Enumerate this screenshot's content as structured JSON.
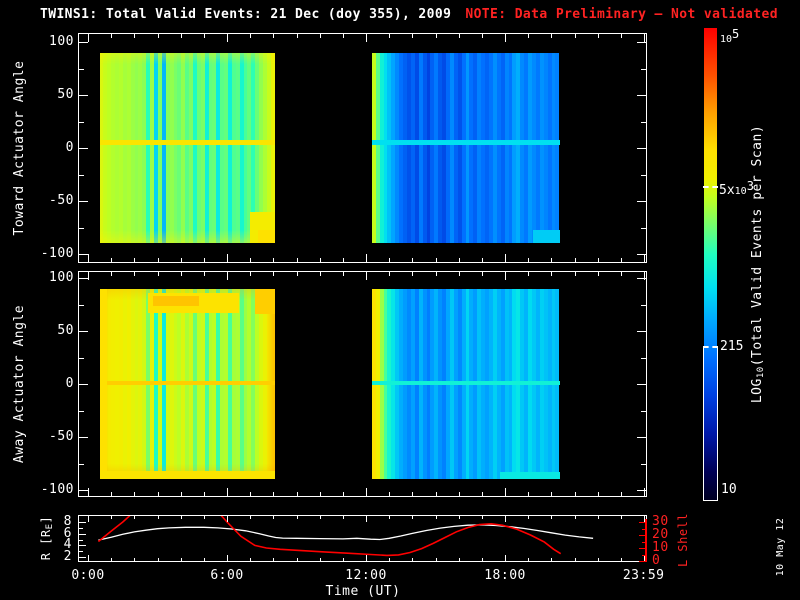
{
  "title": {
    "main": "TWINS1: Total Valid Events: 21 Dec (doy 355), 2009",
    "note": "NOTE: Data Preliminary – Not validated"
  },
  "datestamp": "10 May 12",
  "colors": {
    "background": "#000000",
    "foreground": "#ffffff",
    "note_red": "#ff2222",
    "line_red": "#ff0000",
    "line_white": "#ffffff"
  },
  "colormap": {
    "log10_range": [
      1,
      5
    ],
    "stops": [
      [
        0,
        "#000022"
      ],
      [
        0.06,
        "#000055"
      ],
      [
        0.14,
        "#0018a8"
      ],
      [
        0.22,
        "#0040e0"
      ],
      [
        0.3,
        "#0070ff"
      ],
      [
        0.38,
        "#00a8ff"
      ],
      [
        0.45,
        "#00e0f0"
      ],
      [
        0.52,
        "#20ffc0"
      ],
      [
        0.58,
        "#70ff70"
      ],
      [
        0.64,
        "#c0ff20"
      ],
      [
        0.68,
        "#f0f000"
      ],
      [
        0.74,
        "#ffe000"
      ],
      [
        0.82,
        "#ffa000"
      ],
      [
        0.9,
        "#ff5000"
      ],
      [
        1,
        "#ff0000"
      ]
    ]
  },
  "colorbar": {
    "title_prefix": "LOG",
    "title_sub": "10",
    "title_suffix": "(Total Valid Events per Scan)",
    "top_base": "10",
    "top_sup": "5",
    "mid_prefix": "5x",
    "mid_base": "10",
    "mid_sup": "3",
    "label_215": "215",
    "label_10": "10"
  },
  "time_axis": {
    "label": "Time (UT)",
    "ticks": [
      {
        "hour": 0,
        "label": "0:00"
      },
      {
        "hour": 6,
        "label": "6:00"
      },
      {
        "hour": 12,
        "label": "12:00"
      },
      {
        "hour": 18,
        "label": "18:00"
      },
      {
        "hour": 23.983,
        "label": "23:59"
      }
    ]
  },
  "panels": [
    {
      "id": "toward",
      "ylabel": "Toward Actuator Angle",
      "yticks": [
        100,
        50,
        0,
        -50,
        -100
      ]
    },
    {
      "id": "away",
      "ylabel": "Away Actuator Angle",
      "yticks": [
        100,
        50,
        0,
        -50,
        -100
      ]
    }
  ],
  "strip": {
    "r_label_prefix": "R [R",
    "r_label_sub": "E",
    "r_label_suffix": "]",
    "r_ticks": [
      8,
      6,
      4,
      2
    ],
    "l_label": "L Shell",
    "l_ticks": [
      30,
      20,
      10,
      0
    ]
  },
  "chart_data": {
    "type": "heatmap",
    "title": "TWINS1 Total Valid Events, 21 Dec (doy 355) 2009",
    "x_axis": {
      "label": "Time (UT)",
      "range_hours": [
        0,
        24
      ]
    },
    "y_axis": {
      "label": "Actuator Angle (deg)",
      "range": [
        -100,
        100
      ]
    },
    "value_axis": {
      "label": "LOG10(Total Valid Events per Scan)",
      "log10_range": [
        1,
        5
      ],
      "marked_values": [
        100000,
        5000,
        215,
        10
      ]
    },
    "heatmaps": [
      {
        "panel": "toward",
        "segment": "morning",
        "t0": 0.5,
        "t1": 8.05,
        "angle0": -90,
        "angle1": 90,
        "vignette": "vign-yellow",
        "columns_log10": [
          3.62,
          3.58,
          3.55,
          3.52,
          3.5,
          3.52,
          3.48,
          3.5,
          3.45,
          3.42,
          3.45,
          3.4,
          3.1,
          3.45,
          2.75,
          3.35,
          2.6,
          3.38,
          3.42,
          3.35,
          3.3,
          3.42,
          3.25,
          3.35,
          3.05,
          3.3,
          3.35,
          2.95,
          3.28,
          3.3,
          2.9,
          3.25,
          3.28,
          2.95,
          3.22,
          3.25,
          3.0,
          3.2,
          3.28,
          3.12,
          3.3,
          3.42,
          3.5,
          3.58,
          3.68
        ]
      },
      {
        "panel": "toward",
        "segment": "afternoon",
        "t0": 12.25,
        "t1": 20.35,
        "angle0": -90,
        "angle1": 90,
        "vignette": "",
        "columns_log10": [
          3.58,
          3.25,
          2.95,
          2.8,
          2.65,
          2.5,
          2.35,
          2.2,
          2.1,
          2.0,
          2.12,
          1.95,
          2.25,
          2.05,
          1.9,
          2.1,
          2.25,
          2.05,
          1.95,
          2.15,
          2.35,
          2.12,
          2.0,
          2.2,
          2.42,
          2.2,
          2.1,
          2.3,
          2.2,
          2.12,
          2.22,
          2.38,
          2.22,
          2.12,
          2.32,
          2.22,
          2.45,
          2.55,
          2.35,
          2.25,
          2.45,
          2.35,
          2.25,
          2.4,
          2.32,
          2.22,
          2.35,
          2.3
        ]
      },
      {
        "panel": "away",
        "segment": "morning",
        "t0": 0.5,
        "t1": 8.05,
        "angle0": -90,
        "angle1": 90,
        "vignette": "vign-warm",
        "columns_log10": [
          3.88,
          3.82,
          3.78,
          3.75,
          3.72,
          3.75,
          3.7,
          3.72,
          3.68,
          3.65,
          3.68,
          3.62,
          3.35,
          3.68,
          3.05,
          3.6,
          2.9,
          3.62,
          3.66,
          3.6,
          3.55,
          3.65,
          3.5,
          3.6,
          3.3,
          3.55,
          3.6,
          3.2,
          3.52,
          3.55,
          3.15,
          3.5,
          3.52,
          3.2,
          3.48,
          3.5,
          3.25,
          3.45,
          3.52,
          3.38,
          3.55,
          3.65,
          3.7,
          3.78,
          3.85
        ]
      },
      {
        "panel": "away",
        "segment": "afternoon",
        "t0": 12.25,
        "t1": 20.35,
        "angle0": -90,
        "angle1": 90,
        "vignette": "",
        "columns_log10": [
          3.92,
          3.72,
          3.45,
          3.2,
          3.0,
          2.85,
          2.68,
          2.55,
          2.45,
          2.35,
          2.48,
          2.3,
          2.58,
          2.4,
          2.28,
          2.45,
          2.58,
          2.4,
          2.3,
          2.5,
          2.68,
          2.48,
          2.35,
          2.55,
          2.75,
          2.55,
          2.45,
          2.65,
          2.55,
          2.48,
          2.58,
          2.72,
          2.58,
          2.48,
          2.65,
          2.58,
          2.78,
          2.85,
          2.68,
          2.58,
          2.78,
          2.68,
          2.58,
          2.72,
          2.65,
          2.58,
          2.68,
          2.62
        ]
      }
    ],
    "features": [
      {
        "block": 0,
        "kind": "centerline",
        "angle": 5,
        "half": 2.2,
        "v": 3.88
      },
      {
        "block": 1,
        "kind": "centerline",
        "angle": 5,
        "half": 2.2,
        "v": 2.8
      },
      {
        "block": 2,
        "kind": "centerline",
        "angle": 1,
        "half": 2.2,
        "v": 4.05
      },
      {
        "block": 3,
        "kind": "centerline",
        "angle": 1,
        "half": 2.2,
        "v": 2.95
      },
      {
        "block": 0,
        "kind": "patch",
        "t0": 7.0,
        "t1": 8.05,
        "a0": -90,
        "a1": -60,
        "v": 3.78
      },
      {
        "block": 0,
        "kind": "patch",
        "t0": 7.35,
        "t1": 8.05,
        "a0": -90,
        "a1": -77,
        "v": 3.95
      },
      {
        "block": 2,
        "kind": "patch",
        "t0": 2.6,
        "t1": 6.5,
        "a0": 67,
        "a1": 86,
        "v": 3.92
      },
      {
        "block": 2,
        "kind": "patch",
        "t0": 2.8,
        "t1": 4.8,
        "a0": 74,
        "a1": 83,
        "v": 4.1
      },
      {
        "block": 2,
        "kind": "patch",
        "t0": 7.2,
        "t1": 8.05,
        "a0": 66,
        "a1": 90,
        "v": 4.05
      },
      {
        "block": 2,
        "kind": "patch",
        "t0": 0.5,
        "t1": 0.82,
        "a0": -90,
        "a1": 90,
        "v": 3.95
      },
      {
        "block": 2,
        "kind": "patch",
        "t0": 0.5,
        "t1": 8.05,
        "a0": -90,
        "a1": -82,
        "v": 3.9
      },
      {
        "block": 1,
        "kind": "patch",
        "t0": 19.2,
        "t1": 20.35,
        "a0": -90,
        "a1": -77,
        "v": 2.7
      },
      {
        "block": 3,
        "kind": "patch",
        "t0": 17.8,
        "t1": 20.35,
        "a0": -90,
        "a1": -83,
        "v": 2.88
      }
    ],
    "lines": {
      "R": {
        "label": "R [RE]",
        "axis_ticks": [
          2,
          4,
          6,
          8
        ],
        "points": [
          [
            0.45,
            4.9
          ],
          [
            1.0,
            5.4
          ],
          [
            1.5,
            5.9
          ],
          [
            2.0,
            6.3
          ],
          [
            2.5,
            6.6
          ],
          [
            3.0,
            6.85
          ],
          [
            3.5,
            7.0
          ],
          [
            4.2,
            7.1
          ],
          [
            5.0,
            7.1
          ],
          [
            5.6,
            7.0
          ],
          [
            6.2,
            6.8
          ],
          [
            6.8,
            6.5
          ],
          [
            7.4,
            6.0
          ],
          [
            7.8,
            5.6
          ],
          [
            8.1,
            5.35
          ],
          [
            8.4,
            5.25
          ],
          [
            9.0,
            5.2
          ],
          [
            10.0,
            5.15
          ],
          [
            11.0,
            5.1
          ],
          [
            11.6,
            5.2
          ],
          [
            12.2,
            5.05
          ],
          [
            12.6,
            5.0
          ],
          [
            13.0,
            5.2
          ],
          [
            13.5,
            5.6
          ],
          [
            14.0,
            6.05
          ],
          [
            14.6,
            6.55
          ],
          [
            15.2,
            6.95
          ],
          [
            15.8,
            7.25
          ],
          [
            16.4,
            7.45
          ],
          [
            17.0,
            7.5
          ],
          [
            17.6,
            7.4
          ],
          [
            18.2,
            7.2
          ],
          [
            18.8,
            6.9
          ],
          [
            19.4,
            6.55
          ],
          [
            20.0,
            6.15
          ],
          [
            20.6,
            5.75
          ],
          [
            21.2,
            5.45
          ],
          [
            21.8,
            5.2
          ]
        ]
      },
      "L": {
        "label": "L Shell",
        "axis_ticks": [
          0,
          10,
          20,
          30
        ],
        "points": [
          [
            0.45,
            15
          ],
          [
            1.0,
            23
          ],
          [
            1.5,
            30
          ],
          [
            2.5,
            46
          ],
          [
            5.2,
            46
          ],
          [
            6.0,
            30
          ],
          [
            6.6,
            19
          ],
          [
            7.2,
            12
          ],
          [
            7.7,
            10
          ],
          [
            8.3,
            9
          ],
          [
            9.2,
            8
          ],
          [
            10.2,
            7
          ],
          [
            11.2,
            6
          ],
          [
            12.2,
            5
          ],
          [
            12.9,
            4.3
          ],
          [
            13.4,
            4.7
          ],
          [
            13.9,
            6.5
          ],
          [
            14.4,
            9.5
          ],
          [
            14.9,
            13.5
          ],
          [
            15.4,
            18
          ],
          [
            15.9,
            22.5
          ],
          [
            16.4,
            25.8
          ],
          [
            16.9,
            28
          ],
          [
            17.4,
            28.6
          ],
          [
            17.9,
            27.5
          ],
          [
            18.5,
            24.5
          ],
          [
            19.1,
            20
          ],
          [
            19.7,
            14.5
          ],
          [
            20.1,
            9
          ],
          [
            20.4,
            5.6
          ]
        ]
      }
    }
  }
}
